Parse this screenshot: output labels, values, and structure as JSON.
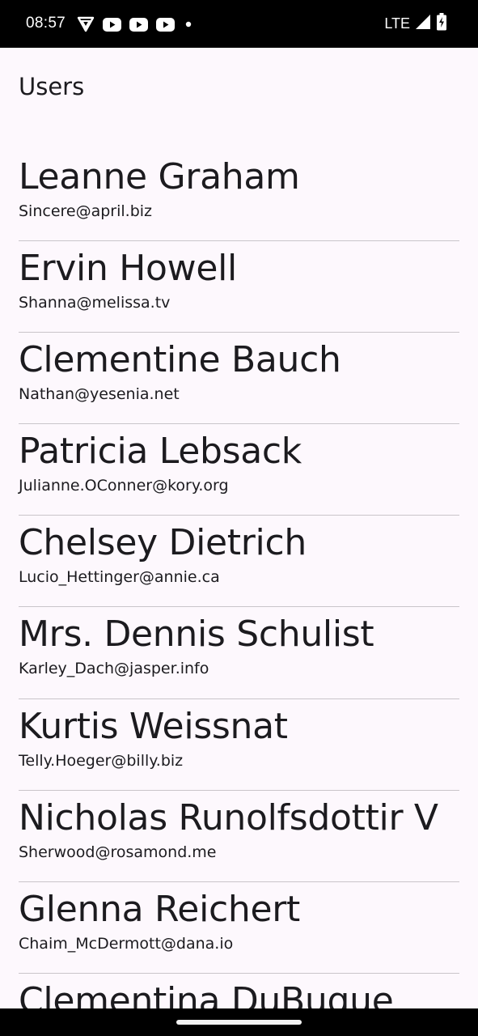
{
  "status_bar": {
    "time": "08:57",
    "network": "LTE",
    "notification_icons": [
      "vpn-shield-icon",
      "youtube-icon",
      "youtube-icon",
      "youtube-icon",
      "dot-icon"
    ],
    "right_icons": [
      "signal-icon",
      "battery-charging-icon"
    ]
  },
  "header": {
    "title": "Users"
  },
  "users": [
    {
      "name": "Leanne Graham",
      "email": "Sincere@april.biz"
    },
    {
      "name": "Ervin Howell",
      "email": "Shanna@melissa.tv"
    },
    {
      "name": "Clementine Bauch",
      "email": "Nathan@yesenia.net"
    },
    {
      "name": "Patricia Lebsack",
      "email": "Julianne.OConner@kory.org"
    },
    {
      "name": "Chelsey Dietrich",
      "email": "Lucio_Hettinger@annie.ca"
    },
    {
      "name": "Mrs. Dennis Schulist",
      "email": "Karley_Dach@jasper.info"
    },
    {
      "name": "Kurtis Weissnat",
      "email": "Telly.Hoeger@billy.biz"
    },
    {
      "name": "Nicholas Runolfsdottir V",
      "email": "Sherwood@rosamond.me"
    },
    {
      "name": "Glenna Reichert",
      "email": "Chaim_McDermott@dana.io"
    },
    {
      "name": "Clementina DuBuque",
      "email": ""
    }
  ],
  "colors": {
    "background": "#fdf8fd",
    "text": "#1c1b1f",
    "divider": "#c9c5ca",
    "system_bar": "#000000"
  }
}
